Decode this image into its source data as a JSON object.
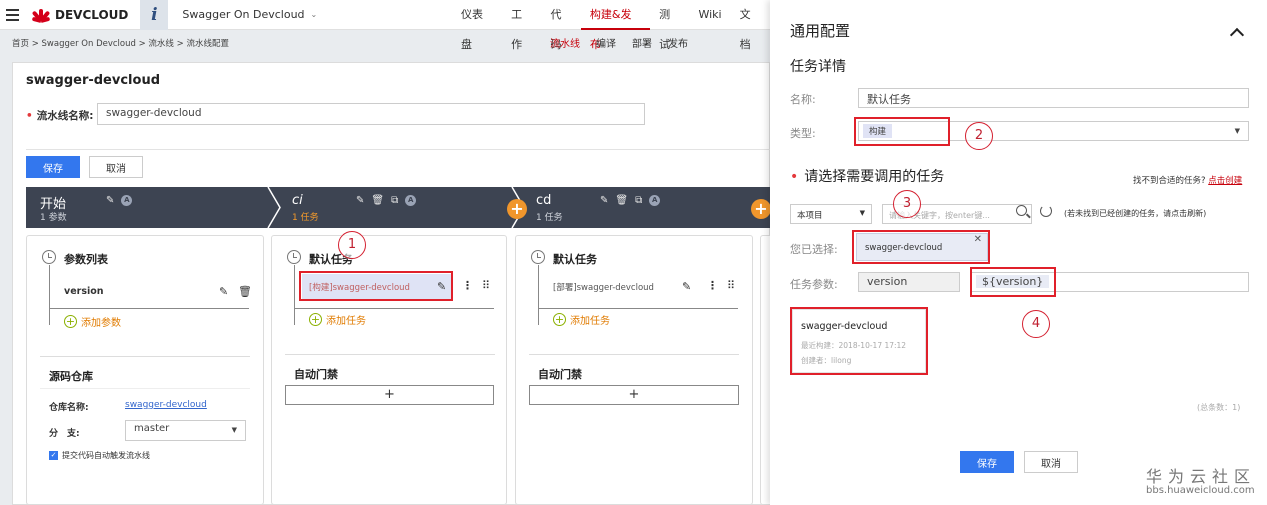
{
  "brand": {
    "name": "DEVCLOUD",
    "project_switch_icon": "i"
  },
  "project": {
    "name": "Swagger On Devcloud"
  },
  "topnav": {
    "items": [
      "仪表盘",
      "工作",
      "代码",
      "构建&发布",
      "测试",
      "Wiki",
      "文档"
    ],
    "active": "构建&发布"
  },
  "breadcrumb": "首页 > Swagger On Devcloud > 流水线 > 流水线配置",
  "subnav": {
    "items": [
      "流水线",
      "编译",
      "部署",
      "发布"
    ],
    "active": "流水线"
  },
  "pipeline": {
    "title": "swagger-devcloud",
    "name_label": "流水线名称:",
    "name_value": "swagger-devcloud",
    "save_label": "保存",
    "cancel_label": "取消"
  },
  "stages": [
    {
      "name": "开始",
      "count": "1 参数"
    },
    {
      "name": "ci",
      "count": "1 任务"
    },
    {
      "name": "cd",
      "count": "1 任务"
    }
  ],
  "stage_badge": "A",
  "col_start": {
    "param_title": "参数列表",
    "param_item": "version",
    "add_param": "添加参数",
    "repo_title": "源码仓库",
    "repo_name_label": "仓库名称:",
    "repo_name_value": "swagger-devcloud",
    "branch_label": "分　支:",
    "branch_value": "master",
    "auto_trigger": "提交代码自动触发流水线"
  },
  "col_ci": {
    "job_title": "默认任务",
    "job_item": "[构建]swagger-devcloud",
    "add_task": "添加任务",
    "gate_title": "自动门禁",
    "gate_add": "+"
  },
  "col_cd": {
    "job_title": "默认任务",
    "job_item": "[部署]swagger-devcloud",
    "add_task": "添加任务",
    "gate_title": "自动门禁",
    "gate_add": "+"
  },
  "callouts": [
    "1",
    "2",
    "3",
    "4"
  ],
  "panel": {
    "title": "通用配置",
    "task_detail": "任务详情",
    "name_label": "名称:",
    "name_value": "默认任务",
    "type_label": "类型:",
    "type_value": "构建",
    "select_section": "请选择需要调用的任务",
    "not_found": "找不到合适的任务?",
    "create_link": "点击创建",
    "scope_value": "本项目",
    "search_placeholder": "请输入关键字，按enter键...",
    "hint": "(若未找到已经创建的任务，请点击刷新)",
    "selected_label": "您已选择:",
    "selected_value": "swagger-devcloud",
    "params_label": "任务参数:",
    "param_name": "version",
    "param_value": "${version}",
    "result_name": "swagger-devcloud",
    "result_built": "最近构建：2018-10-17 17:12",
    "result_creator": "创建者：lilong",
    "total": "(总条数：1)",
    "save_label": "保存",
    "cancel_label": "取消"
  },
  "watermark": {
    "line1": "华为云社区",
    "line2": "bbs.huaweicloud.com"
  },
  "colors": {
    "accent": "#c7000b",
    "primary": "#3377ee",
    "stage_bg": "#3d4452",
    "add_orange": "#f0962c",
    "highlight": "#e0202a"
  }
}
